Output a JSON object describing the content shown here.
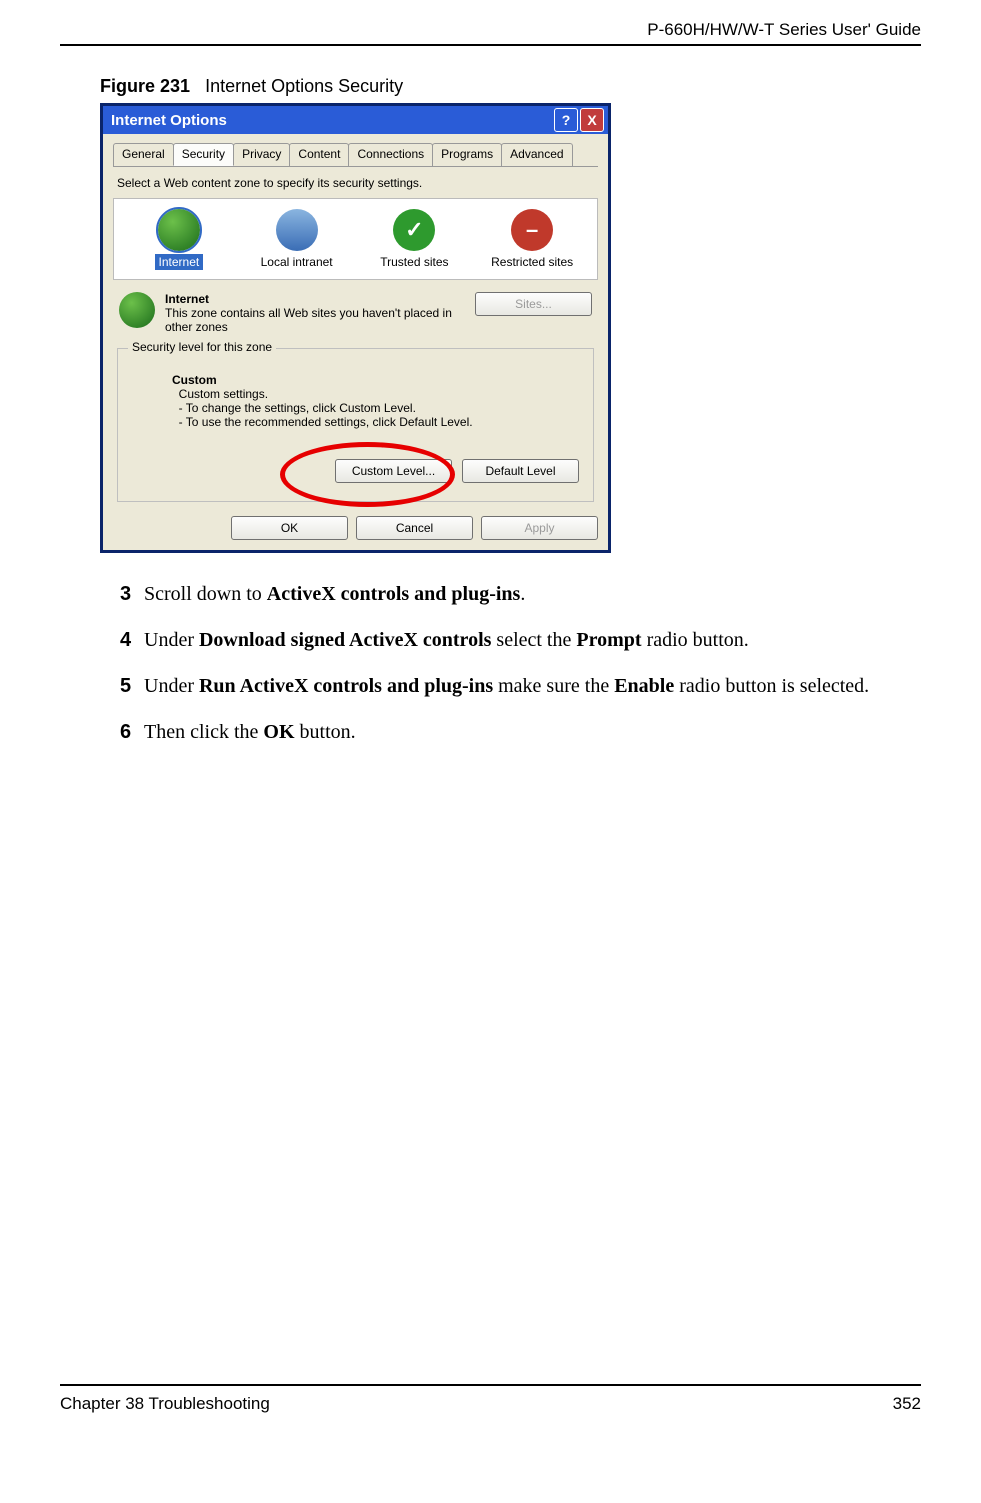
{
  "header": {
    "guide_title": "P-660H/HW/W-T Series User' Guide"
  },
  "figure": {
    "label": "Figure 231",
    "title": "Internet Options Security"
  },
  "dialog": {
    "title": "Internet Options",
    "tabs": [
      "General",
      "Security",
      "Privacy",
      "Content",
      "Connections",
      "Programs",
      "Advanced"
    ],
    "active_tab_index": 1,
    "instruction": "Select a Web content zone to specify its security settings.",
    "zones": [
      {
        "label": "Internet",
        "selected": true
      },
      {
        "label": "Local intranet",
        "selected": false
      },
      {
        "label": "Trusted sites",
        "selected": false
      },
      {
        "label": "Restricted sites",
        "selected": false
      }
    ],
    "zone_detail": {
      "name": "Internet",
      "desc": "This zone contains all Web sites you haven't placed in other zones",
      "sites_button": "Sites..."
    },
    "security_group": {
      "legend": "Security level for this zone",
      "custom_title": "Custom",
      "line1": "Custom settings.",
      "line2": "- To change the settings, click Custom Level.",
      "line3": "- To use the recommended settings, click Default Level.",
      "custom_level_btn": "Custom Level...",
      "default_level_btn": "Default Level"
    },
    "buttons": {
      "ok": "OK",
      "cancel": "Cancel",
      "apply": "Apply"
    }
  },
  "steps": [
    {
      "num": "3",
      "pre": "Scroll down to ",
      "b1": "ActiveX controls and plug-ins",
      "post": "."
    },
    {
      "num": "4",
      "pre": "Under ",
      "b1": "Download signed ActiveX controls",
      "mid": " select the ",
      "b2": "Prompt",
      "post": " radio button."
    },
    {
      "num": "5",
      "pre": "Under ",
      "b1": "Run ActiveX controls and plug-ins",
      "mid": " make sure the ",
      "b2": "Enable",
      "post": " radio button is selected."
    },
    {
      "num": "6",
      "pre": "Then click the ",
      "b1": "OK",
      "post": " button."
    }
  ],
  "footer": {
    "chapter": "Chapter 38 Troubleshooting",
    "page": "352"
  }
}
